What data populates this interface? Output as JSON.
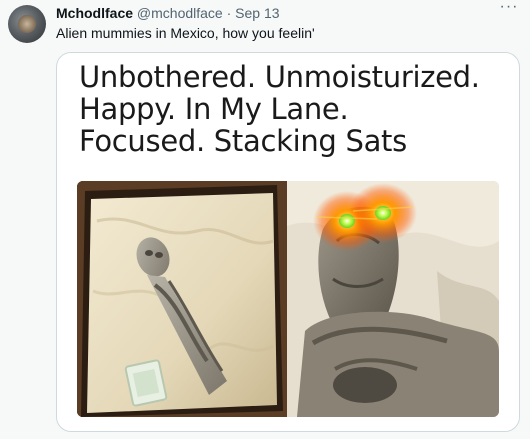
{
  "tweet": {
    "author_name": "Mchodlface",
    "author_handle": "@mchodlface",
    "separator": "·",
    "date": "Sep 13",
    "text": "Alien mummies in Mexico, how you feelin'",
    "more_icon": "more-dots-icon"
  },
  "media": {
    "caption_lines": "Unbothered. Unmoisturized.\nHappy. In My Lane.\nFocused. Stacking Sats",
    "left_image": "mummy-in-box-image",
    "right_image": "mummy-head-glowing-eyes-image",
    "eye_glow_color": "#ff9a00",
    "eye_core_color": "#9dff3a"
  }
}
